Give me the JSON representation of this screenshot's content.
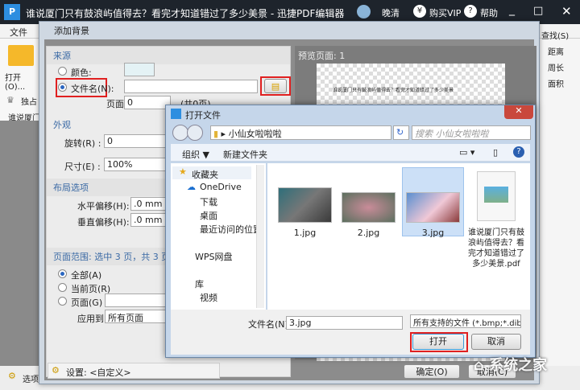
{
  "app": {
    "title": "谁说厦门只有鼓浪屿值得去？看完才知道错过了多少美景 - 迅捷PDF编辑器",
    "user": "晚清",
    "vip": "购买VIP",
    "help": "帮助"
  },
  "menu": {
    "file": "文件",
    "open": "打开(O)...",
    "exclusive": "独占",
    "doc_tab": "谁说厦门",
    "options": "选项"
  },
  "right_tools": {
    "find": "查找(S)",
    "distance": "距离",
    "perimeter": "周长",
    "area": "面积"
  },
  "bg_dialog": {
    "title": "添加背景",
    "source": "来源",
    "color": "颜色:",
    "filename": "文件名(N):",
    "filename_value": "",
    "page_label": "页面:",
    "page_value": "0",
    "page_total": "(共0页)",
    "appearance": "外观",
    "rotate": "旋转(R) :",
    "rotate_value": "0",
    "size": "尺寸(E) :",
    "size_value": "100%",
    "layout": "布局选项",
    "h_offset": "水平偏移(H):",
    "h_value": ".0 mm",
    "v_offset": "垂直偏移(H):",
    "v_value": ".0 mm",
    "range_label": "页面范围: 选中 3 页，共 3 页",
    "all": "全部(A)",
    "current": "当前页(R)",
    "pages": "页面(G)",
    "apply_to": "应用到:",
    "apply_value": "所有页面",
    "settings": "设置: <自定义>",
    "preview": "预览页面: 1",
    "preview_title": "谁说厦门只有鼓浪屿值得去？看完才知道错过了多少美景",
    "ok": "确定(O)",
    "cancel": "取消(C)"
  },
  "open_dialog": {
    "title": "打开文件",
    "path": "小仙女啦啦啦",
    "search_placeholder": "搜索 小仙女啦啦啦",
    "organize": "组织 ▼",
    "new_folder": "新建文件夹",
    "nav": [
      "收藏夹",
      "OneDrive",
      "下载",
      "桌面",
      "最近访问的位置",
      "WPS网盘",
      "库",
      "视频"
    ],
    "files": [
      "1.jpg",
      "2.jpg",
      "3.jpg",
      "谁说厦门只有鼓浪屿值得去？看完才知道错过了多少美景.pdf"
    ],
    "selected": "3.jpg",
    "filename_label": "文件名(N):",
    "filename_value": "3.jpg",
    "filter": "所有支持的文件 (*.bmp;*.dib;*",
    "open": "打开",
    "cancel": "取消"
  },
  "watermark": "系统之家",
  "colors": {
    "highlight": "#e02020",
    "selection": "#cce0f7"
  }
}
